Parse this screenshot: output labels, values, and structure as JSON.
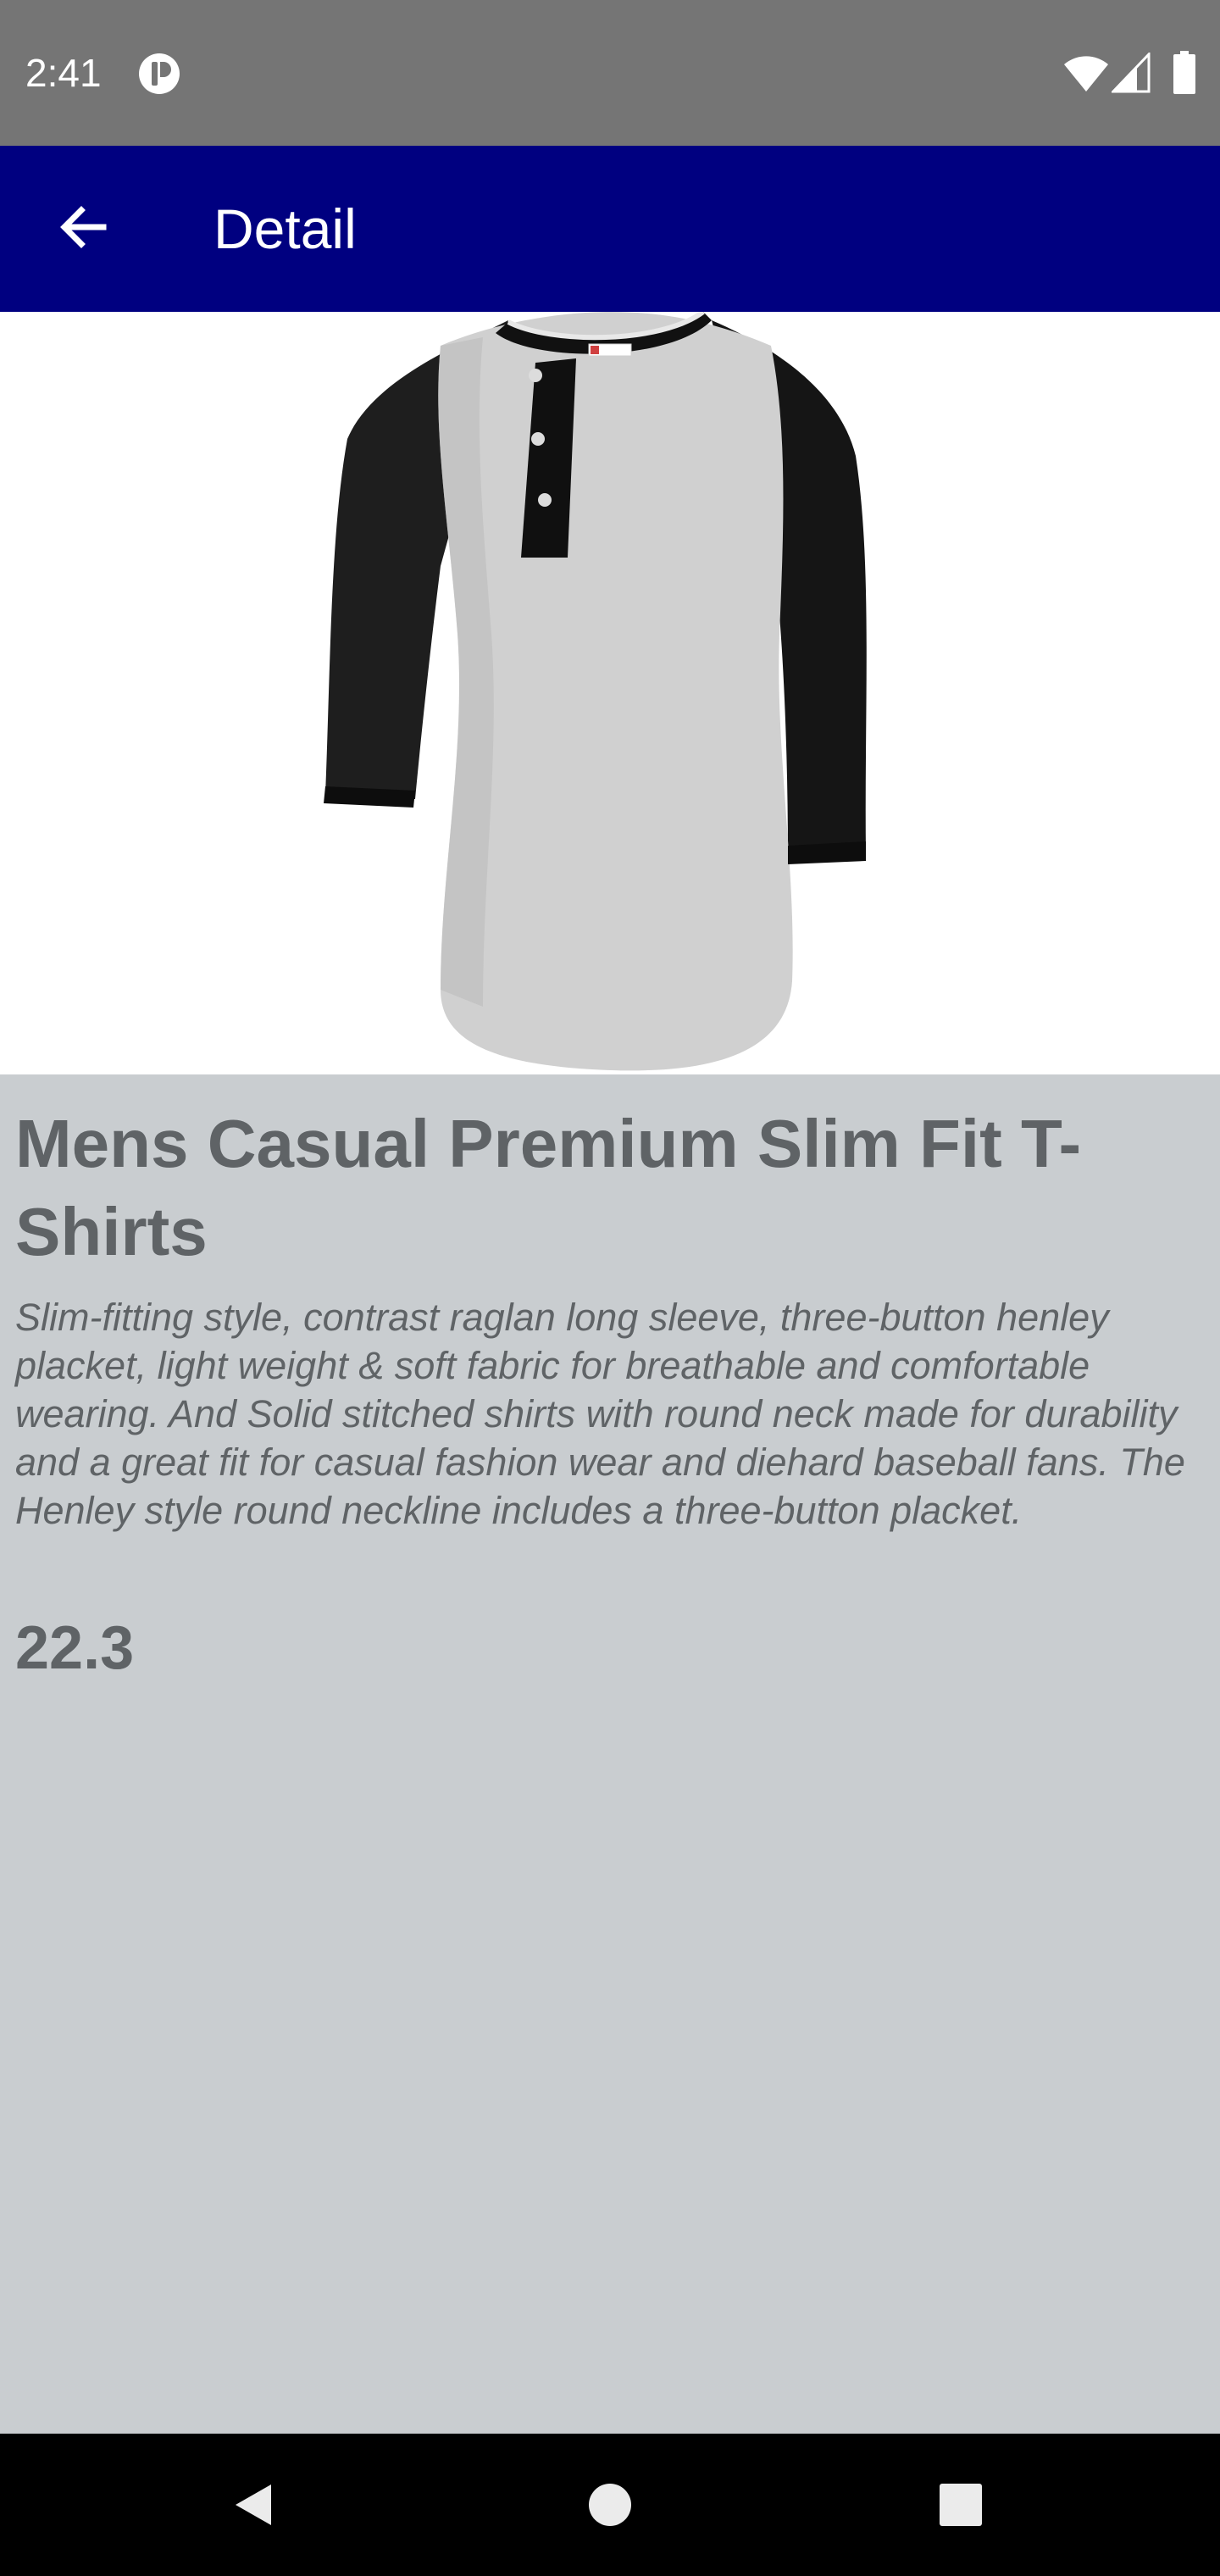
{
  "status_bar": {
    "time": "2:41",
    "icons": [
      "app-notification-icon",
      "wifi-icon",
      "cellular-signal-icon",
      "battery-icon"
    ]
  },
  "app_bar": {
    "title": "Detail",
    "back_icon": "arrow-back-icon",
    "background_color": "#000080"
  },
  "product": {
    "image_description": "henley-raglan-tshirt",
    "title": "Mens Casual Premium Slim Fit T-Shirts",
    "description": "Slim-fitting style, contrast raglan long sleeve, three-button henley placket, light weight & soft fabric for breathable and comfortable wearing. And Solid stitched shirts with round neck made for durability and a great fit for casual fashion wear and diehard baseball fans. The Henley style round neckline includes a three-button placket.",
    "price": "22.3"
  },
  "nav_bar": {
    "icons": [
      "nav-back-icon",
      "nav-home-icon",
      "nav-recents-icon"
    ]
  },
  "colors": {
    "status_bar": "#757575",
    "app_bar": "#000080",
    "content_background": "#c9cdd0",
    "text": "#5f6366",
    "nav_bar": "#000000"
  }
}
